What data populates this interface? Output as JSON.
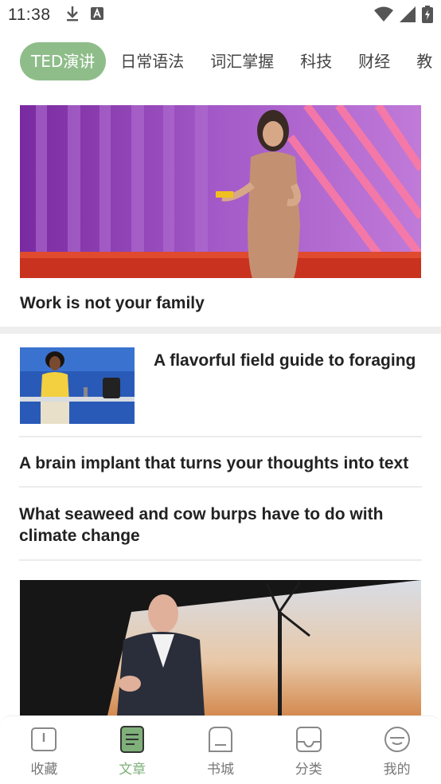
{
  "status_bar": {
    "time": "11:38",
    "icons_left": [
      "download-icon",
      "a-notification-icon"
    ],
    "icons_right": [
      "wifi-icon",
      "cell-signal-icon",
      "battery-charging-icon"
    ]
  },
  "tabs": [
    {
      "label": "TED演讲",
      "active": true
    },
    {
      "label": "日常语法",
      "active": false
    },
    {
      "label": "词汇掌握",
      "active": false
    },
    {
      "label": "科技",
      "active": false
    },
    {
      "label": "财经",
      "active": false
    },
    {
      "label": "教",
      "active": false
    }
  ],
  "articles": {
    "featured_1": {
      "title": "Work is not your family"
    },
    "item_1": {
      "title": "A flavorful field guide to foraging"
    },
    "item_2": {
      "title": "A brain implant that turns your thoughts into text"
    },
    "item_3": {
      "title": "What seaweed and cow burps have to do with climate change"
    }
  },
  "bottom_nav": [
    {
      "label": "收藏",
      "icon": "book-open-icon",
      "active": false
    },
    {
      "label": "文章",
      "icon": "article-icon",
      "active": true
    },
    {
      "label": "书城",
      "icon": "shelf-icon",
      "active": false
    },
    {
      "label": "分类",
      "icon": "tray-icon",
      "active": false
    },
    {
      "label": "我的",
      "icon": "face-icon",
      "active": false
    }
  ],
  "colors": {
    "accent": "#8fbd8a",
    "nav_active": "#7fb07a"
  }
}
